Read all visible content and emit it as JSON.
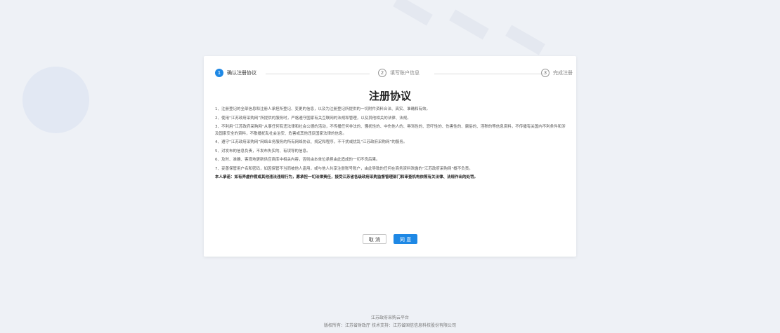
{
  "steps": [
    {
      "number": "1",
      "label": "确认注册协议",
      "state": "active"
    },
    {
      "number": "2",
      "label": "填写账户信息",
      "state": "inactive"
    },
    {
      "number": "3",
      "label": "完成注册",
      "state": "inactive"
    }
  ],
  "agreement": {
    "title": "注册协议",
    "clauses": [
      "1、注册登记的全部信息和注册人承担所登记、变更的信息，以及为注册登记所提供的一切附件资料合法、真实、准确和有效。",
      "2、使用“江苏政府采购网”所提供的服务时，严格遵守国家有关互联网的法规和管理，以及其他相关的法律、法规。",
      "3、不利用“江苏政府采购网”从事任何有违法律和社会公德的活动，不传播任何非法的、骚扰性的、中伤他人的、辱骂性的、恐吓性的、伤害性的、庸俗的、淫秽的等信息资料，不传播有关国内不利条件和涉及国家安全的资料，不散播扰乱社会治安、危害或其他违反国家法律的信息。",
      "4、遵守“江苏政府采购网”网络业务服务的所有网络协议、规定和程序，不干扰或扰乱“江苏政府采购网”的服务。",
      "5、对发布的信息负责，不发布失实的、有误导的信息。",
      "6、及时、准确、客观地更新供应商库中相关内容，否则由本单位承担由此造成的一切不良后果。",
      "7、妥善保管用户名和密码，如因保管不当而被他人盗用，或与他人共享注册账号账户，由此导致的任何在商务资料泄露的“江苏政府采购网”概不负责。"
    ],
    "commitment": "本人承诺：如有弄虚作假或其他违法违规行为，愿承担一切法律责任，接受江苏省各级政府采购监督管理部门和审查机构依照有关法律、法规作出的处罚。"
  },
  "buttons": {
    "cancel": "取 消",
    "agree": "同 意"
  },
  "footer": {
    "platform": "江苏政府采购云平台",
    "copyright": "版权所有：江苏省财政厅    技术支持：江苏省国信信息科技股份有限公司"
  },
  "colors": {
    "accent": "#1e88e5",
    "background": "#eef1f6"
  }
}
